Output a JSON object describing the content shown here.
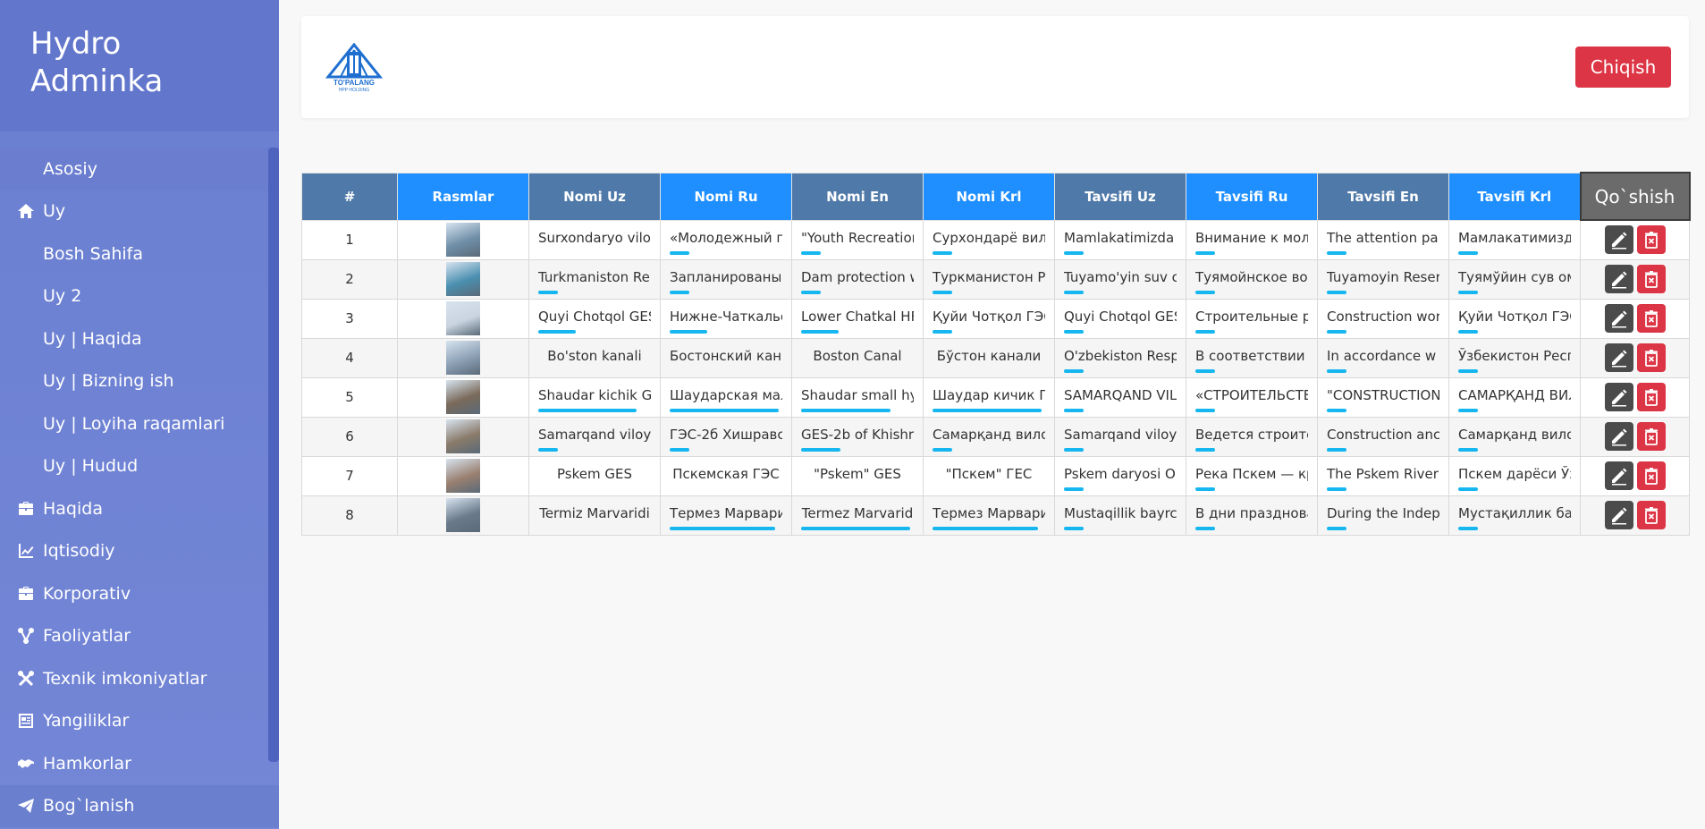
{
  "sidebar": {
    "brand": "Hydro\nAdminka",
    "items": [
      {
        "label": "Asosiy",
        "icon": "",
        "kind": "sub",
        "first": true
      },
      {
        "label": "Uy",
        "icon": "home-icon",
        "kind": "top"
      },
      {
        "label": "Bosh Sahifa",
        "icon": "",
        "kind": "sub"
      },
      {
        "label": "Uy 2",
        "icon": "",
        "kind": "sub"
      },
      {
        "label": "Uy | Haqida",
        "icon": "",
        "kind": "sub"
      },
      {
        "label": "Uy | Bizning ish",
        "icon": "",
        "kind": "sub"
      },
      {
        "label": "Uy | Loyiha raqamlari",
        "icon": "",
        "kind": "sub"
      },
      {
        "label": "Uy | Hudud",
        "icon": "",
        "kind": "sub"
      },
      {
        "label": "Haqida",
        "icon": "briefcase-icon",
        "kind": "top"
      },
      {
        "label": "Iqtisodiy",
        "icon": "chart-line-icon",
        "kind": "top"
      },
      {
        "label": "Korporativ",
        "icon": "briefcase-icon",
        "kind": "top"
      },
      {
        "label": "Faoliyatlar",
        "icon": "network-icon",
        "kind": "top"
      },
      {
        "label": "Texnik imkoniyatlar",
        "icon": "tools-icon",
        "kind": "top"
      },
      {
        "label": "Yangiliklar",
        "icon": "newspaper-icon",
        "kind": "top"
      },
      {
        "label": "Hamkorlar",
        "icon": "handshake-icon",
        "kind": "top"
      },
      {
        "label": "Bog`lanish",
        "icon": "paper-plane-icon",
        "kind": "top",
        "active": true
      }
    ]
  },
  "header": {
    "logo_text": "TO'PALANG",
    "logo_subtext": "HPP HOLDING",
    "logout_label": "Chiqish"
  },
  "table": {
    "columns": [
      "#",
      "Rasmlar",
      "Nomi Uz",
      "Nomi Ru",
      "Nomi En",
      "Nomi Krl",
      "Tavsifi Uz",
      "Tavsifi Ru",
      "Tavsifi En",
      "Tavsifi Krl"
    ],
    "add_label": "Qo`shish",
    "rows": [
      {
        "n": "1",
        "thumb": "#6f8fa8",
        "cells": [
          "Surxondaryo vilo",
          "«Молодежный пар",
          "\"Youth Recreatior",
          "Сурхондарё вилоя",
          "Mamlakatimizda",
          "Внимание к молод",
          "The attention pa",
          "Мамлакатимизда"
        ],
        "ul": [
          0,
          22,
          22,
          22,
          22,
          22,
          22,
          22
        ],
        "center": [
          false,
          false,
          false,
          false,
          false,
          false,
          false,
          false
        ]
      },
      {
        "n": "2",
        "thumb": "#4a8fb0",
        "cells": [
          "Turkmaniston Re",
          "Запланированы р",
          "Dam protection w",
          "Туркманистон Рес",
          "Tuyamo'yin suv c",
          "Туямойнское водо",
          "Tuyamoyin Reser",
          "Туямўйин сув омб"
        ],
        "ul": [
          22,
          22,
          22,
          22,
          22,
          22,
          22,
          22
        ],
        "center": [
          false,
          false,
          false,
          false,
          false,
          false,
          false,
          false
        ]
      },
      {
        "n": "3",
        "thumb": "#c9d4e0",
        "cells": [
          "Quyi Chotqol GES",
          "Нижне-Чаткальск",
          "Lower Chatkal HF",
          "Қуйи Чотқол ГЭС:",
          "Quyi Chotqol GES",
          "Строительные раб",
          "Construction wor",
          "Қуйи Чотқол ГЭС с"
        ],
        "ul": [
          42,
          42,
          42,
          22,
          22,
          22,
          22,
          22
        ],
        "center": [
          false,
          false,
          false,
          false,
          false,
          false,
          false,
          false
        ]
      },
      {
        "n": "4",
        "thumb": "#8ca0b5",
        "cells": [
          "Bo'ston kanali",
          "Бостонский канал",
          "Boston Canal",
          "Бўстон канали",
          "O'zbekiston Resp",
          "В соответствии с Г",
          "In accordance w",
          "Ўзбекистон Респу"
        ],
        "ul": [
          0,
          0,
          0,
          0,
          22,
          22,
          22,
          22
        ],
        "center": [
          true,
          false,
          true,
          true,
          false,
          false,
          false,
          false
        ]
      },
      {
        "n": "5",
        "thumb": "#7a6a5a",
        "cells": [
          "Shaudar kichik G",
          "Шаударская мала",
          "Shaudar small hy",
          "Шаудар кичик ГЕС",
          "SAMARQAND VILC",
          "«СТРОИТЕЛЬСТВ",
          "\"CONSTRUCTION",
          "САМАРҚАНД ВИЛ"
        ],
        "ul": [
          110,
          122,
          100,
          122,
          22,
          22,
          22,
          22
        ],
        "center": [
          false,
          false,
          false,
          false,
          false,
          false,
          false,
          false
        ]
      },
      {
        "n": "6",
        "thumb": "#8a7b6a",
        "cells": [
          "Samarqand viloy",
          "ГЭС-2б Хишравс",
          "GES-2b of Khishra",
          "Самарқанд вилоя",
          "Samarqand viloy",
          "Ведется строител",
          "Construction anc",
          "Самарқанд вилоя"
        ],
        "ul": [
          22,
          22,
          44,
          22,
          22,
          22,
          22,
          22
        ],
        "center": [
          false,
          false,
          false,
          false,
          false,
          false,
          false,
          false
        ]
      },
      {
        "n": "7",
        "thumb": "#9a8070",
        "cells": [
          "Pskem GES",
          "Пскемская ГЭС",
          "\"Pskem\" GES",
          "\"Пскем\" ГЕС",
          "Pskem daryosi O",
          "Река Пскем — кру",
          "The Pskem River",
          "Пскем дарёси Ўзб"
        ],
        "ul": [
          0,
          0,
          0,
          0,
          22,
          22,
          22,
          22
        ],
        "center": [
          true,
          true,
          true,
          true,
          false,
          false,
          false,
          false
        ]
      },
      {
        "n": "8",
        "thumb": "#6a7a8a",
        "cells": [
          "Termiz Marvaridi",
          "Термез Марварид",
          "Termez Marvarid",
          "Термез Марварид",
          "Mustaqillik bayrc",
          "В дни празднован",
          "During the Indep",
          "Мустақиллик байр"
        ],
        "ul": [
          0,
          118,
          122,
          118,
          22,
          22,
          22,
          22
        ],
        "center": [
          true,
          true,
          true,
          true,
          false,
          false,
          false,
          false
        ]
      }
    ]
  },
  "colors": {
    "sidebar": "#6a7fd1",
    "header_dark": "#4f79a8",
    "header_light": "#1f8fff",
    "underline": "#16b7f0",
    "danger": "#dc3545",
    "edit": "#4b4b4b"
  }
}
